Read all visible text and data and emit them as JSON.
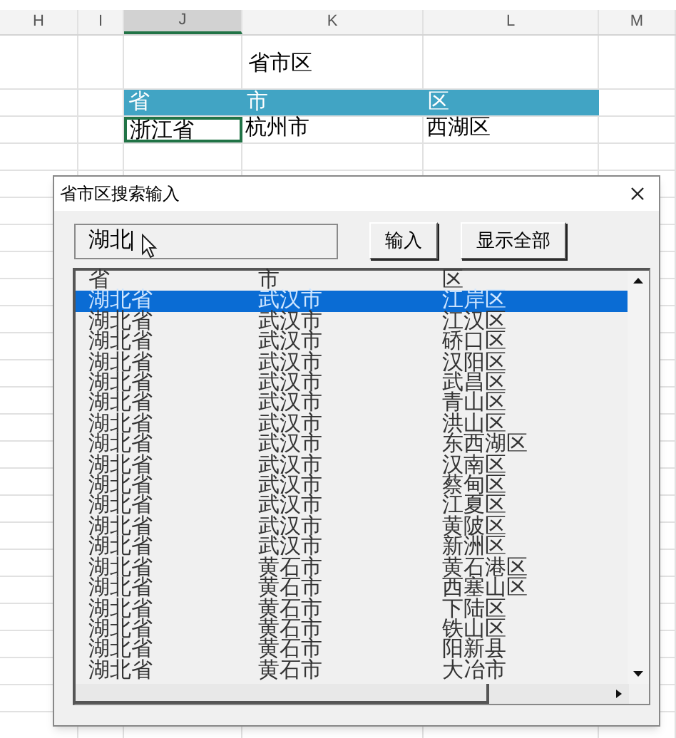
{
  "sheet": {
    "columns": [
      {
        "label": "H",
        "selected": false
      },
      {
        "label": "I",
        "selected": false
      },
      {
        "label": "J",
        "selected": true
      },
      {
        "label": "K",
        "selected": false
      },
      {
        "label": "L",
        "selected": false
      },
      {
        "label": "M",
        "selected": false
      }
    ],
    "title": "省市区",
    "table_header": [
      "省",
      "市",
      "区"
    ],
    "table_row": [
      {
        "text": "浙江省",
        "selected": true
      },
      {
        "text": "杭州市",
        "selected": false
      },
      {
        "text": "西湖区",
        "selected": false
      }
    ]
  },
  "dialog": {
    "title": "省市区搜索输入",
    "search": {
      "value": "湖北"
    },
    "buttons": [
      "输入",
      "显示全部"
    ],
    "list": {
      "columns": [
        "省",
        "市",
        "区"
      ],
      "rows": [
        {
          "cells": [
            "湖北省",
            "武汉市",
            "江岸区"
          ],
          "selected": true
        },
        {
          "cells": [
            "湖北省",
            "武汉市",
            "江汉区"
          ],
          "selected": false
        },
        {
          "cells": [
            "湖北省",
            "武汉市",
            "硚口区"
          ],
          "selected": false
        },
        {
          "cells": [
            "湖北省",
            "武汉市",
            "汉阳区"
          ],
          "selected": false
        },
        {
          "cells": [
            "湖北省",
            "武汉市",
            "武昌区"
          ],
          "selected": false
        },
        {
          "cells": [
            "湖北省",
            "武汉市",
            "青山区"
          ],
          "selected": false
        },
        {
          "cells": [
            "湖北省",
            "武汉市",
            "洪山区"
          ],
          "selected": false
        },
        {
          "cells": [
            "湖北省",
            "武汉市",
            "东西湖区"
          ],
          "selected": false
        },
        {
          "cells": [
            "湖北省",
            "武汉市",
            "汉南区"
          ],
          "selected": false
        },
        {
          "cells": [
            "湖北省",
            "武汉市",
            "蔡甸区"
          ],
          "selected": false
        },
        {
          "cells": [
            "湖北省",
            "武汉市",
            "江夏区"
          ],
          "selected": false
        },
        {
          "cells": [
            "湖北省",
            "武汉市",
            "黄陂区"
          ],
          "selected": false
        },
        {
          "cells": [
            "湖北省",
            "武汉市",
            "新洲区"
          ],
          "selected": false
        },
        {
          "cells": [
            "湖北省",
            "黄石市",
            "黄石港区"
          ],
          "selected": false
        },
        {
          "cells": [
            "湖北省",
            "黄石市",
            "西塞山区"
          ],
          "selected": false
        },
        {
          "cells": [
            "湖北省",
            "黄石市",
            "下陆区"
          ],
          "selected": false
        },
        {
          "cells": [
            "湖北省",
            "黄石市",
            "铁山区"
          ],
          "selected": false
        },
        {
          "cells": [
            "湖北省",
            "黄石市",
            "阳新县"
          ],
          "selected": false
        },
        {
          "cells": [
            "湖北省",
            "黄石市",
            "大冶市"
          ],
          "selected": false
        }
      ]
    }
  }
}
